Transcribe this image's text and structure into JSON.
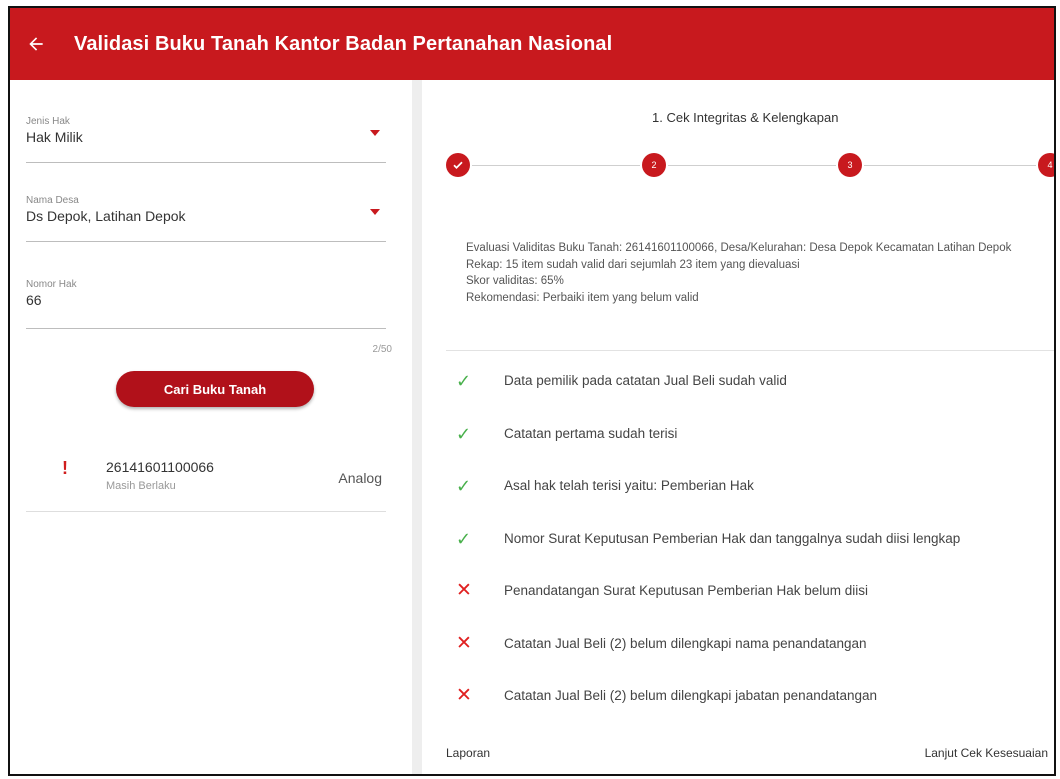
{
  "appbar": {
    "title": "Validasi Buku Tanah Kantor Badan Pertanahan Nasional",
    "back_icon": "arrow-left-icon"
  },
  "form": {
    "jenis_hak": {
      "label": "Jenis Hak",
      "value": "Hak Milik"
    },
    "nama_desa": {
      "label": "Nama Desa",
      "value": "Ds Depok, Latihan Depok"
    },
    "nomor_hak": {
      "label": "Nomor Hak",
      "value": "66",
      "counter": "2/50"
    },
    "search_button": "Cari Buku Tanah"
  },
  "result": {
    "number": "26141601100066",
    "status": "Masih Berlaku",
    "type": "Analog",
    "icon": "exclamation-icon"
  },
  "stepper": {
    "title": "1. Cek Integritas & Kelengkapan",
    "steps": [
      "1",
      "2",
      "3",
      "4"
    ],
    "completed_steps": 1
  },
  "summary": {
    "line1": "Evaluasi Validitas Buku Tanah: 26141601100066, Desa/Kelurahan: Desa Depok Kecamatan Latihan Depok",
    "line2": "Rekap: 15 item sudah valid dari sejumlah 23 item yang dievaluasi",
    "line3": "Skor validitas: 65%",
    "line4": "Rekomendasi: Perbaiki item yang belum valid"
  },
  "checks": [
    {
      "status": "valid",
      "text": "Data pemilik pada catatan Jual Beli sudah valid"
    },
    {
      "status": "valid",
      "text": "Catatan pertama sudah terisi"
    },
    {
      "status": "valid",
      "text": "Asal hak telah terisi yaitu: Pemberian Hak"
    },
    {
      "status": "valid",
      "text": "Nomor Surat Keputusan Pemberian Hak dan tanggalnya sudah diisi lengkap"
    },
    {
      "status": "invalid",
      "text": "Penandatangan Surat Keputusan Pemberian Hak belum diisi"
    },
    {
      "status": "invalid",
      "text": "Catatan Jual Beli (2) belum dilengkapi nama penandatangan"
    },
    {
      "status": "invalid",
      "text": "Catatan Jual Beli (2) belum dilengkapi jabatan penandatangan"
    }
  ],
  "footer": {
    "left": "Laporan",
    "right": "Lanjut Cek Kesesuaian"
  },
  "colors": {
    "primary": "#c8191e",
    "valid": "#48b04b",
    "invalid": "#e02020"
  }
}
